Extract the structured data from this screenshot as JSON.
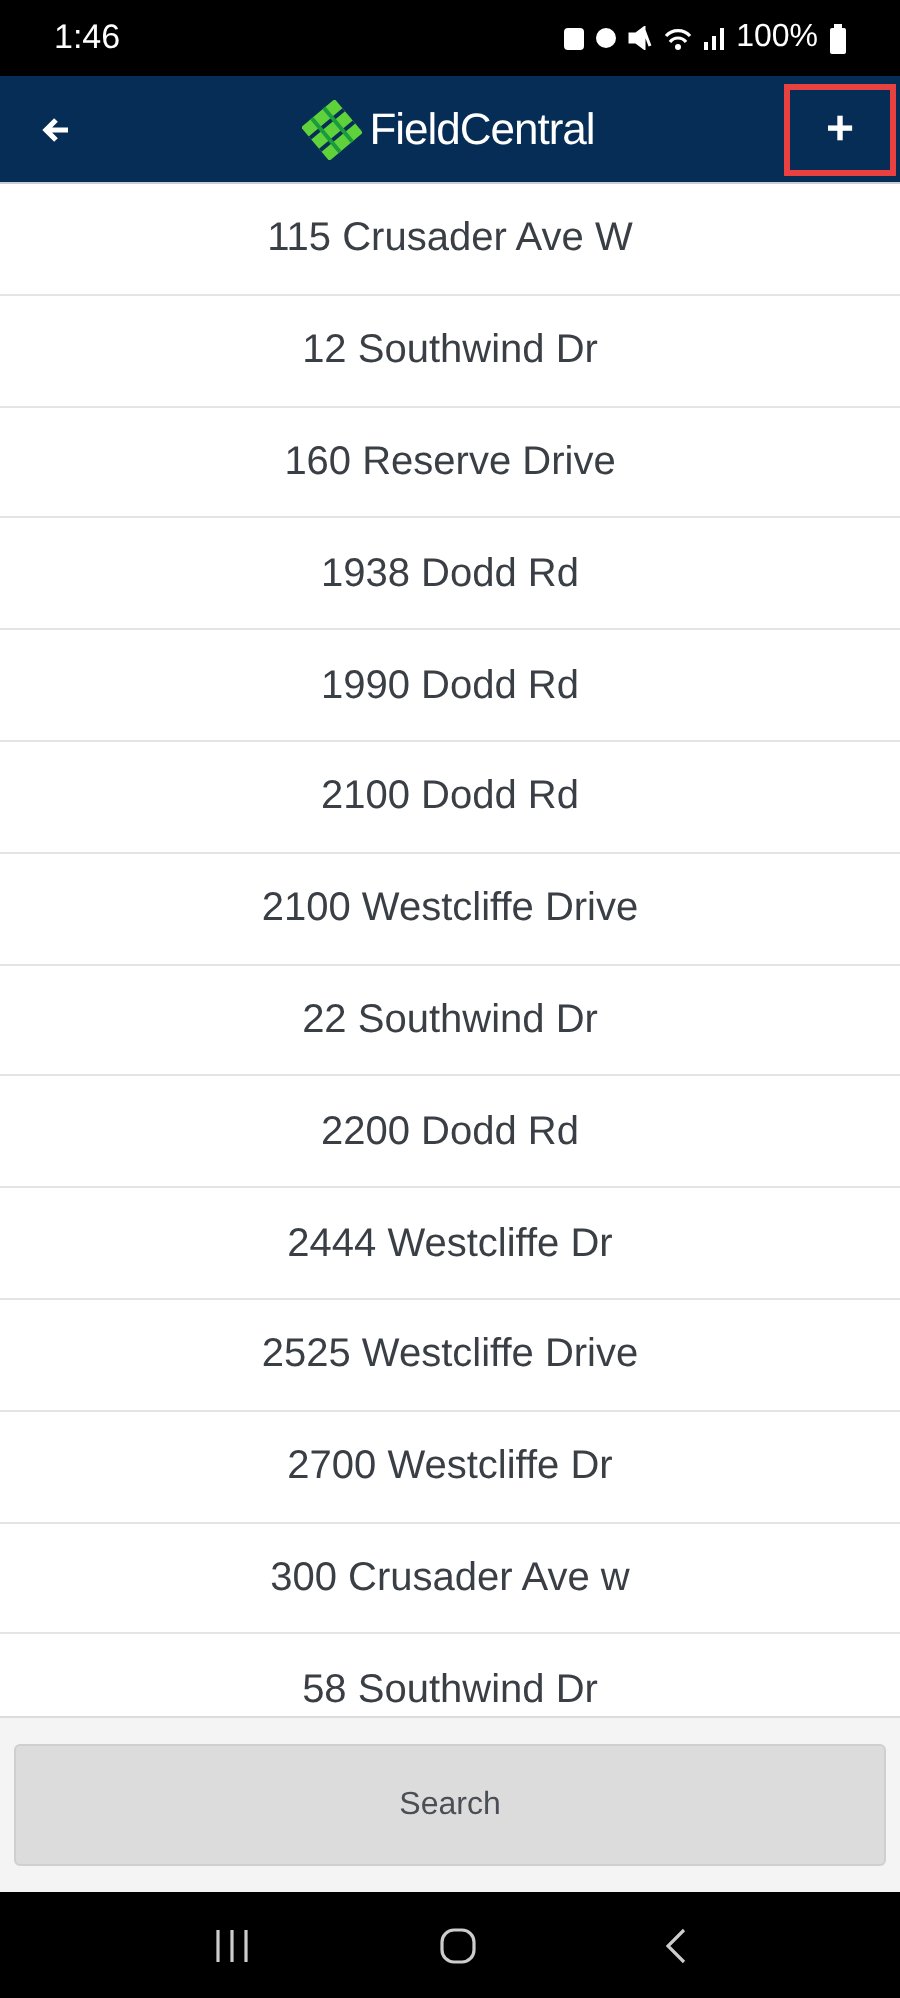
{
  "status_bar": {
    "time": "1:46",
    "battery": "100%"
  },
  "header": {
    "logo_text": "FieldCentral",
    "add_button": {
      "label": "+",
      "highlighted": true
    }
  },
  "addresses": [
    "115 Crusader Ave W",
    "12 Southwind Dr",
    "160 Reserve Drive",
    "1938 Dodd Rd",
    "1990 Dodd Rd",
    "2100 Dodd Rd",
    "2100 Westcliffe Drive",
    "22 Southwind Dr",
    "2200 Dodd Rd",
    "2444 Westcliffe Dr",
    "2525 Westcliffe Drive",
    "2700 Westcliffe Dr",
    "300 Crusader Ave w",
    "58 Southwind Dr"
  ],
  "search_button": "Search"
}
